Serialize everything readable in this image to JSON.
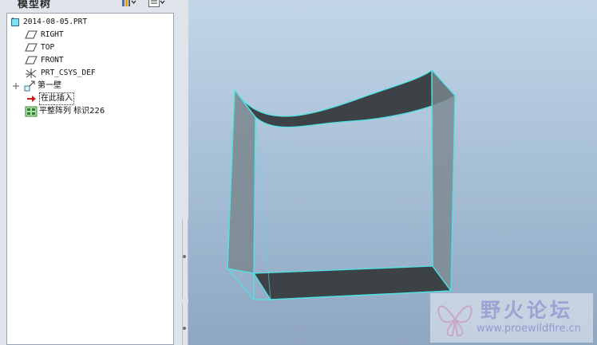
{
  "panel": {
    "title": "模型树"
  },
  "tree": {
    "root": "2014-08-05.PRT",
    "items": [
      {
        "label": "RIGHT",
        "icon": "datum-plane-icon"
      },
      {
        "label": "TOP",
        "icon": "datum-plane-icon"
      },
      {
        "label": "FRONT",
        "icon": "datum-plane-icon"
      },
      {
        "label": "PRT_CSYS_DEF",
        "icon": "coordinate-system-icon"
      },
      {
        "label": "第一壁",
        "icon": "wall-feature-icon"
      },
      {
        "label": "在此插入",
        "icon": "insert-here-arrow-icon"
      },
      {
        "label": "平整阵列 标识226",
        "icon": "pattern-icon"
      }
    ]
  },
  "watermark": {
    "title": "野火论坛",
    "url": "www.proewildfire.cn"
  },
  "colors": {
    "selection_edge": "#4fe3e6",
    "solid_dark": "#3c4246",
    "solid_side": "#6f7a80",
    "background_top": "#c2d6e6",
    "background_bottom": "#8fa6c1",
    "insert_arrow": "#cc1b1b"
  }
}
